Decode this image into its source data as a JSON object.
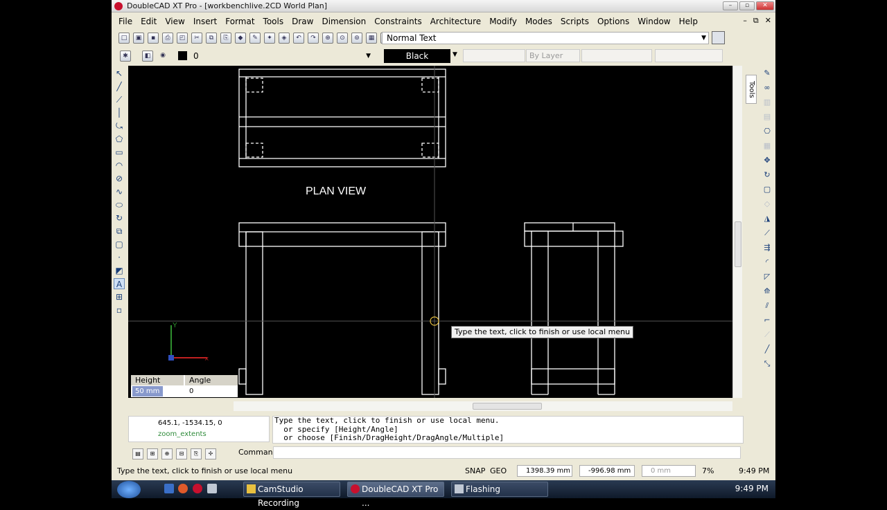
{
  "window": {
    "title": "DoubleCAD XT Pro - [workbenchlive.2CD World Plan]",
    "buttons": [
      "–",
      "▫",
      "✕"
    ]
  },
  "menu": {
    "items": [
      "File",
      "Edit",
      "View",
      "Insert",
      "Format",
      "Tools",
      "Draw",
      "Dimension",
      "Constraints",
      "Architecture",
      "Modify",
      "Modes",
      "Scripts",
      "Options",
      "Window",
      "Help"
    ],
    "right": [
      "–",
      "⧉",
      "✕"
    ]
  },
  "toolbar": {
    "text_style": "Normal Text",
    "layer_value": "0",
    "color": "Black",
    "linetype": "By Layer"
  },
  "drawing": {
    "plan_label": "PLAN VIEW",
    "axis_y": "Y",
    "tooltip": "Type the text, click to finish or use local menu"
  },
  "dim_panel": {
    "height_label": "Height",
    "angle_label": "Angle",
    "height_value": "50 mm",
    "angle_value": "0"
  },
  "history": {
    "coords": "645.1, -1534.15, 0",
    "last_cmd": "zoom_extents"
  },
  "command": {
    "lines": [
      "Type the text, click to finish or use local menu.",
      "  or specify [Height/Angle]",
      "  or choose [Finish/DragHeight/DragAngle/Multiple]"
    ],
    "label": "Command:"
  },
  "status": {
    "message": "Type the text, click to finish or use local menu",
    "snap": "SNAP",
    "geo": "GEO",
    "x": "1398.39 mm",
    "y": "-996.98 mm",
    "z": "0 mm",
    "zoom": "7%",
    "time": "9:49 PM"
  },
  "taskbar": {
    "tasks": [
      "CamStudio Recording",
      "DoubleCAD XT Pro ...",
      "Flashing"
    ],
    "time": "9:49 PM"
  },
  "colors": {
    "canvas": "#000000",
    "lines": "#ffffff",
    "chrome": "#ece9d8",
    "accent": "#c8102e"
  }
}
